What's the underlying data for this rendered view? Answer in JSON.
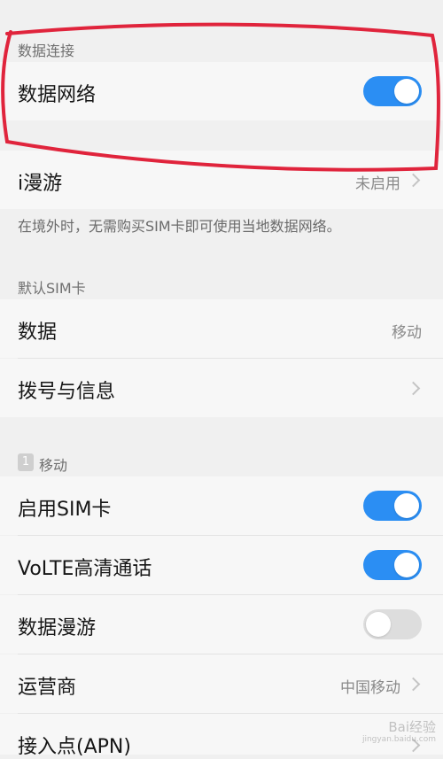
{
  "data_connection": {
    "header": "数据连接",
    "mobile_network": {
      "label": "数据网络",
      "enabled": true
    }
  },
  "roaming": {
    "label": "i漫游",
    "value": "未启用",
    "note": "在境外时，无需购买SIM卡即可使用当地数据网络。"
  },
  "default_sim": {
    "header": "默认SIM卡",
    "items": [
      {
        "label": "数据",
        "value": "移动"
      },
      {
        "label": "拨号与信息",
        "value": ""
      }
    ]
  },
  "sim1": {
    "badge": "1",
    "header": "移动",
    "items": [
      {
        "label": "启用SIM卡",
        "enabled": true
      },
      {
        "label": "VoLTE高清通话",
        "enabled": true
      },
      {
        "label": "数据漫游",
        "enabled": false
      },
      {
        "label": "运营商",
        "value": "中国移动"
      },
      {
        "label": "接入点(APN)",
        "value": ""
      }
    ]
  },
  "watermark": {
    "text": "Bai经验",
    "subtext": "jingyan.baidu.com"
  },
  "colors": {
    "toggle_on": "#2b8ef3",
    "toggle_off": "#dddddd",
    "annotation": "#e0243c"
  }
}
